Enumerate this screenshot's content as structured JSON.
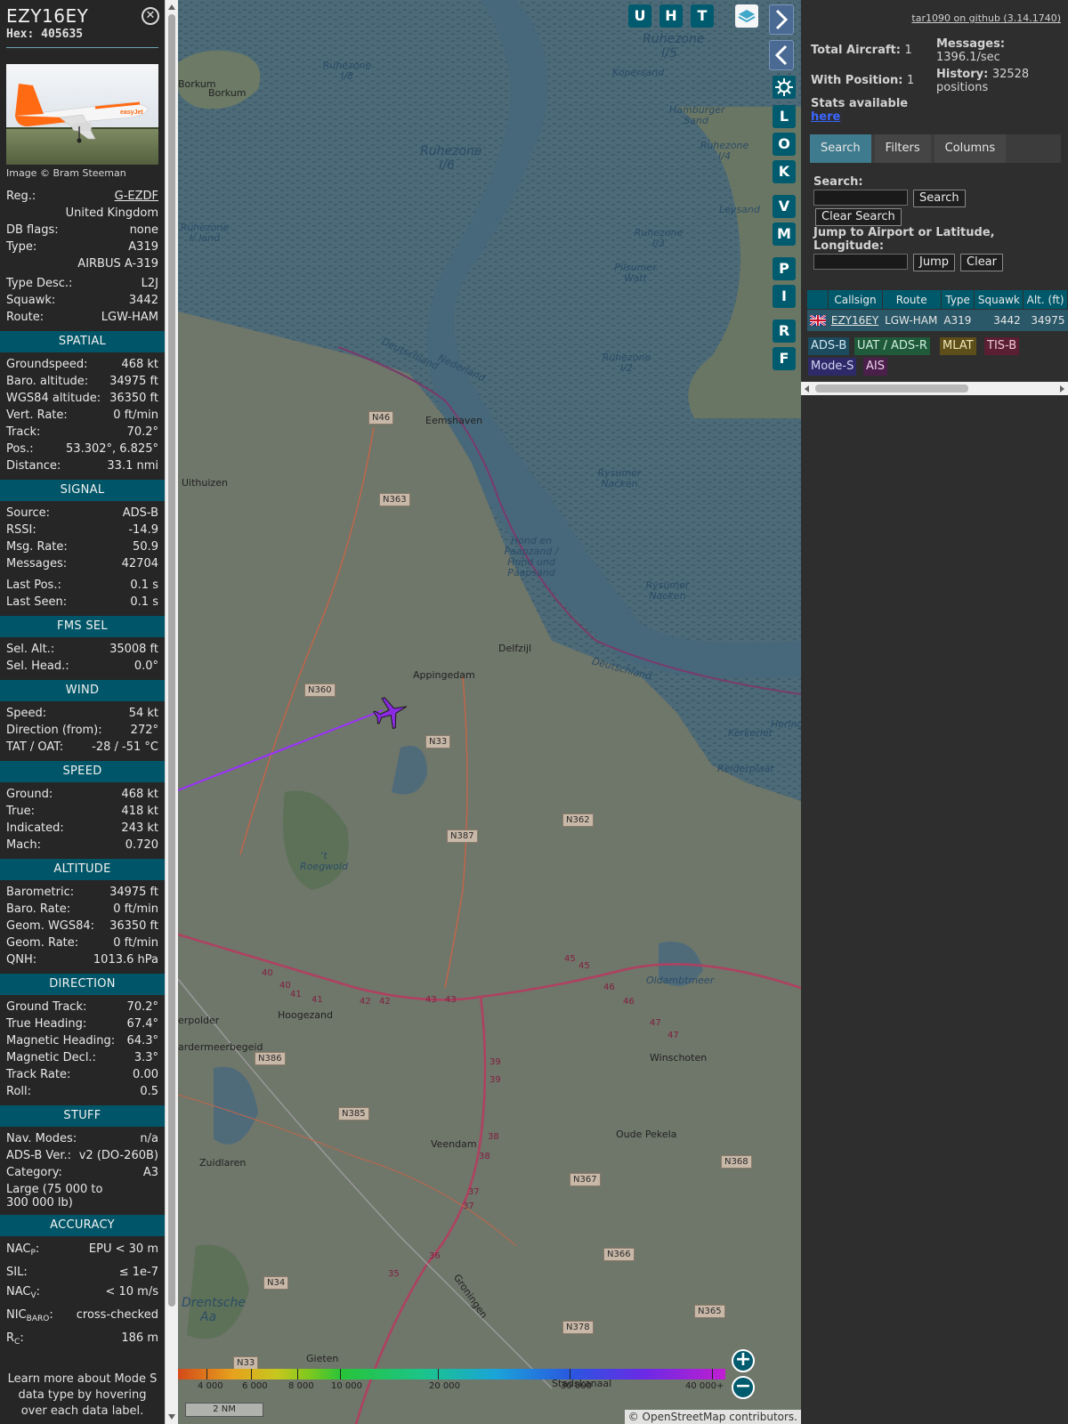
{
  "aircraft": {
    "callsign": "EZY16EY",
    "hex_label": "Hex:",
    "hex": "405635",
    "close_glyph": "✕",
    "image_credit": "Image © Bram Steeman"
  },
  "details": [
    {
      "label": "Reg.:",
      "value": "G-EZDF",
      "link": true
    },
    {
      "label": "",
      "value": "United Kingdom"
    },
    {
      "label": "DB flags:",
      "value": "none"
    },
    {
      "label": "Type:",
      "value": "A319"
    },
    {
      "label": "",
      "value": "AIRBUS A-319"
    },
    {
      "label": "Type Desc.:",
      "value": "L2J"
    },
    {
      "label": "Squawk:",
      "value": "3442"
    },
    {
      "label": "Route:",
      "value": "LGW-HAM"
    }
  ],
  "sections": [
    {
      "title": "SPATIAL",
      "rows": [
        {
          "label": "Groundspeed:",
          "value": "468 kt"
        },
        {
          "label": "Baro. altitude:",
          "value": "34975 ft"
        },
        {
          "label": "WGS84 altitude:",
          "value": "36350 ft"
        },
        {
          "label": "Vert. Rate:",
          "value": "0 ft/min"
        },
        {
          "label": "Track:",
          "value": "70.2°"
        },
        {
          "label": "Pos.:",
          "value": "53.302°, 6.825°"
        },
        {
          "label": "Distance:",
          "value": "33.1 nmi"
        }
      ]
    },
    {
      "title": "SIGNAL",
      "rows": [
        {
          "label": "Source:",
          "value": "ADS-B"
        },
        {
          "label": "RSSI:",
          "value": "-14.9"
        },
        {
          "label": "Msg. Rate:",
          "value": "50.9"
        },
        {
          "label": "Messages:",
          "value": "42704"
        },
        {
          "label": "Last Pos.:",
          "value": "0.1 s"
        },
        {
          "label": "Last Seen:",
          "value": "0.1 s"
        }
      ]
    },
    {
      "title": "FMS SEL",
      "rows": [
        {
          "label": "Sel. Alt.:",
          "value": "35008 ft"
        },
        {
          "label": "Sel. Head.:",
          "value": "0.0°"
        }
      ]
    },
    {
      "title": "WIND",
      "rows": [
        {
          "label": "Speed:",
          "value": "54 kt"
        },
        {
          "label": "Direction (from):",
          "value": "272°"
        },
        {
          "label": "TAT / OAT:",
          "value": "-28 / -51 °C"
        }
      ]
    },
    {
      "title": "SPEED",
      "rows": [
        {
          "label": "Ground:",
          "value": "468 kt"
        },
        {
          "label": "True:",
          "value": "418 kt"
        },
        {
          "label": "Indicated:",
          "value": "243 kt"
        },
        {
          "label": "Mach:",
          "value": "0.720"
        }
      ]
    },
    {
      "title": "ALTITUDE",
      "rows": [
        {
          "label": "Barometric:",
          "value": "34975 ft"
        },
        {
          "label": "Baro. Rate:",
          "value": "0 ft/min"
        },
        {
          "label": "Geom. WGS84:",
          "value": "36350 ft"
        },
        {
          "label": "Geom. Rate:",
          "value": "0 ft/min"
        },
        {
          "label": "QNH:",
          "value": "1013.6 hPa"
        }
      ]
    },
    {
      "title": "DIRECTION",
      "rows": [
        {
          "label": "Ground Track:",
          "value": "70.2°"
        },
        {
          "label": "True Heading:",
          "value": "67.4°"
        },
        {
          "label": "Magnetic Heading:",
          "value": "64.3°"
        },
        {
          "label": "Magnetic Decl.:",
          "value": "3.3°"
        },
        {
          "label": "Track Rate:",
          "value": "0.00"
        },
        {
          "label": "Roll:",
          "value": "0.5"
        }
      ]
    },
    {
      "title": "STUFF",
      "rows": [
        {
          "label": "Nav. Modes:",
          "value": "n/a"
        },
        {
          "label": "ADS-B Ver.:",
          "value": "v2 (DO-260B)"
        },
        {
          "label": "Category:",
          "value": "A3"
        },
        {
          "label": "",
          "value": "Large (75 000 to 300 000 lb)",
          "multi": true
        }
      ]
    }
  ],
  "accuracy": {
    "title": "ACCURACY",
    "rows": [
      {
        "main": "NAC",
        "sub": "P",
        "suffix": ":",
        "value": "EPU < 30 m"
      },
      {
        "main": "SIL:",
        "sub": "",
        "suffix": "",
        "value": "≤ 1e-7"
      },
      {
        "main": "NAC",
        "sub": "V",
        "suffix": ":",
        "value": "< 10 m/s"
      },
      {
        "main": "NIC",
        "sub": "BARO",
        "suffix": ":",
        "value": "cross-checked"
      },
      {
        "main": "R",
        "sub": "C",
        "suffix": ":",
        "value": "186 m"
      }
    ]
  },
  "learn_more": "Learn more about Mode S data type by hovering over each data label.",
  "map": {
    "buttons_top": [
      "U",
      "H",
      "T"
    ],
    "buttons_side": [
      "L",
      "O",
      "K",
      "V",
      "M",
      "P",
      "I",
      "R",
      "F"
    ],
    "icons": {
      "layers": "layers-icon",
      "settings": "gear-icon"
    },
    "labels": {
      "borkum": "Borkum",
      "borkum2": "Borkum",
      "ruhezone_i5": "Ruhezone I/5",
      "ruhezone_i6": "Ruhezone I/6",
      "ruhezone_i8": "Ruhezone I/8",
      "ruhezone_i4": "Ruhezone I/4",
      "ruhezone_i3": "Ruhezone I/3",
      "ruhezone_i2": "Ruhezone I/2",
      "ruhezone_land": "Ruhezone I/ land",
      "kopersand": "Kopersand",
      "hamburger_sand": "Hamburger Sand",
      "leysand": "Leysand",
      "pilsumer_watt": "Pilsumer Watt",
      "rysumer_nacken": "Rysumer Nacken",
      "rysumer_nacken2": "Rysumer Nacken",
      "hond_paap": "Hond en Paapzand / Hund und Paapsand",
      "deutschland": "Deutschland",
      "nederland": "Nederland",
      "deutschland2": "Deutschland",
      "eemshaven": "Eemshaven",
      "uithuizen": "Uithuizen",
      "delfzijl": "Delfzijl",
      "appingedam": "Appingedam",
      "kerkeriet": "Kerkeriet",
      "reiderplaat": "Reiderplaat",
      "hering": "Hering",
      "roegwold": "'t Roegwold",
      "oldambtmeer": "Oldambtmeer",
      "hoogezand": "Hoogezand",
      "winschoten": "Winschoten",
      "polder": "erpolder",
      "meerbeg": "ardermeerbegeid",
      "veendam": "Veendam",
      "oude_pekela": "Oude Pekela",
      "zuidlaren": "Zuidlaren",
      "drentsche_aa": "Drentsche Aa",
      "gieten": "Gieten",
      "groningen": "Groningen",
      "stadskanaal": "Stadskanaal"
    },
    "roads": [
      "N46",
      "N363",
      "N360",
      "N33",
      "N362",
      "N387",
      "N386",
      "N385",
      "N367",
      "N368",
      "N366",
      "N34",
      "N378",
      "N365",
      "N33"
    ],
    "motorway_km": [
      "40",
      "40",
      "41",
      "41",
      "42",
      "42",
      "43",
      "43",
      "45",
      "45",
      "46",
      "46",
      "47",
      "47",
      "39",
      "39",
      "38",
      "38",
      "37",
      "37",
      "36",
      "35"
    ],
    "altitude_scale": [
      "4 000",
      "6 000",
      "8 000",
      "10 000",
      "20 000",
      "30 000",
      "40 000+"
    ],
    "scale_label": "2 NM",
    "attribution_pre": "© ",
    "attribution_link": "OpenStreetMap",
    "attribution_post": " contributors.",
    "track_color": "#9b30ff",
    "aircraft_color": "#8a2be2"
  },
  "right": {
    "github": "tar1090 on github (3.14.1740)",
    "total_aircraft_label": "Total Aircraft:",
    "total_aircraft": "1",
    "with_position_label": "With Position:",
    "with_position": "1",
    "messages_label": "Messages:",
    "messages": "1396.1/sec",
    "history_label": "History:",
    "history": "32528 positions",
    "stats_label": "Stats available",
    "stats_link": "here",
    "tabs": [
      "Search",
      "Filters",
      "Columns"
    ],
    "search_label": "Search:",
    "search_button": "Search",
    "clear_search_button": "Clear Search",
    "jump_label": "Jump to Airport or Latitude, Longitude:",
    "jump_button": "Jump",
    "clear_button": "Clear",
    "table": {
      "headers": [
        "",
        "Callsign",
        "Route",
        "Type",
        "Squawk",
        "Alt. (ft)"
      ],
      "rows": [
        {
          "flag": "gb-flag-icon",
          "callsign": "EZY16EY",
          "route": "LGW-HAM",
          "type": "A319",
          "squawk": "3442",
          "alt": "34975"
        }
      ]
    },
    "sources": [
      {
        "label": "ADS-B",
        "bg": "#1c4a5e",
        "fg": "#cfe6f2"
      },
      {
        "label": "UAT / ADS-R",
        "bg": "#1f5a3a",
        "fg": "#cdeedd"
      },
      {
        "label": "MLAT",
        "bg": "#5e4f1a",
        "fg": "#f2e6b8"
      },
      {
        "label": "TIS-B",
        "bg": "#5a1f33",
        "fg": "#f2c8d6"
      },
      {
        "label": "Mode-S",
        "bg": "#2e2a6a",
        "fg": "#d6d2f2"
      },
      {
        "label": "AIS",
        "bg": "#4a1f4a",
        "fg": "#eed0ee"
      }
    ]
  }
}
